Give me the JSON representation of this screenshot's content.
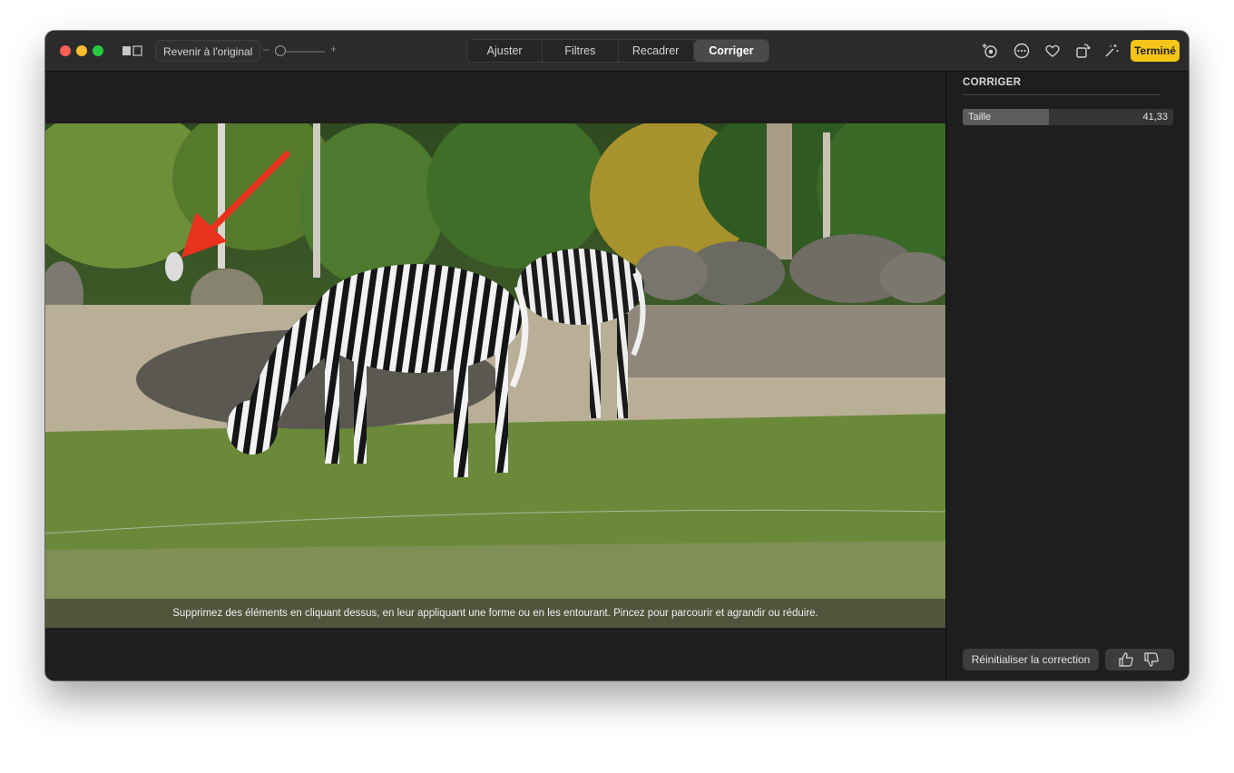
{
  "toolbar": {
    "revert_label": "Revenir à l'original",
    "zoom_minus": "–",
    "zoom_plus": "+",
    "zoom_level": 0.05,
    "tabs": [
      {
        "label": "Ajuster"
      },
      {
        "label": "Filtres"
      },
      {
        "label": "Recadrer"
      },
      {
        "label": "Corriger",
        "active": true
      }
    ],
    "icons": [
      "compare-icon",
      "auto-enhance-icon",
      "more-icon",
      "favorite-heart-icon",
      "rotate-icon",
      "magic-wand-icon"
    ],
    "done_label": "Terminé",
    "done_color": "#f5c518"
  },
  "canvas": {
    "hint": "Supprimez des éléments en cliquant dessus, en leur appliquant une forme ou en les entourant. Pincez pour parcourir et agrandir ou réduire.",
    "annotation_arrow_color": "#e8321e"
  },
  "panel": {
    "title": "CORRIGER",
    "size_label": "Taille",
    "size_value": "41,33",
    "reset_label": "Réinitialiser la correction"
  }
}
